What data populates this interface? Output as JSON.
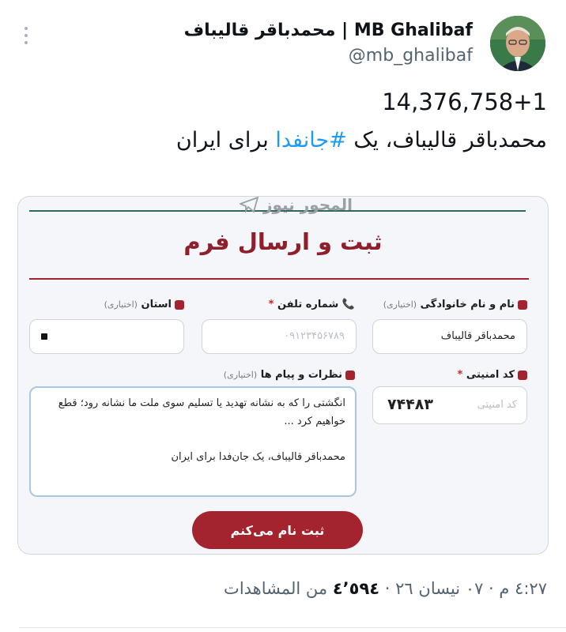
{
  "header": {
    "display_name": "MB Ghalibaf | محمدباقر قالیباف",
    "handle": "@mb_ghalibaf"
  },
  "tweet": {
    "line1": "14,376,758+1",
    "line2_before": "محمدباقر قالیباف، یک ",
    "hashtag": "#جانفدا",
    "line2_after": " برای ایران"
  },
  "card": {
    "watermark": "المحور نيوز",
    "form_title": "ثبت و ارسال فرم",
    "fields": {
      "name": {
        "label": "نام و نام خانوادگی",
        "optional": "(اختیاری)",
        "value": "محمدباقر قالیباف"
      },
      "phone": {
        "label": "شماره تلفن",
        "required": "*",
        "placeholder": "۰۹۱۲۳۴۵۶۷۸۹"
      },
      "province": {
        "label": "استان",
        "optional": "(اختیاری)"
      },
      "code": {
        "label": "کد امنیتی",
        "required": "*",
        "placeholder": "کد امنیتی",
        "captcha": "۷۴۴۸۳"
      },
      "message": {
        "label": "نظرات و پیام ها",
        "optional": "(اختیاری)",
        "line1": "انگشتی را که به نشانه تهدید یا تسلیم سوی ملت ما نشانه رود؛ قطع خواهیم کرد ...",
        "line2": "محمدباقر قالیباف، یک جان‌فدا برای ایران"
      }
    },
    "submit_label": "ثبت نام می‌کنم"
  },
  "meta": {
    "time_date": "٤:٢٧ م · ٠٧ نيسان ٢٦ ·",
    "views_count": "٤٬٥٩٤",
    "views_label": "من المشاهدات"
  },
  "colors": {
    "accent_red": "#a3232f",
    "accent_green": "#2e6a5a",
    "link_blue": "#1d9bf0",
    "muted_text": "#536471"
  }
}
